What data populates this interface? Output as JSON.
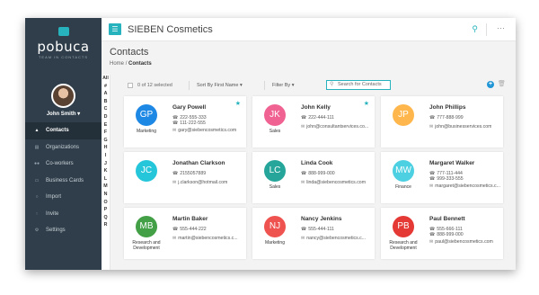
{
  "app": {
    "logo_text": "pobuca",
    "logo_tagline": "TEAM IN CONTACTS",
    "company": "SIEBEN Cosmetics"
  },
  "user": {
    "name": "John Smith ▾"
  },
  "sidebar": {
    "items": [
      {
        "label": "Contacts",
        "icon": "person-icon",
        "active": true
      },
      {
        "label": "Organizations",
        "icon": "building-icon",
        "active": false
      },
      {
        "label": "Co-workers",
        "icon": "people-icon",
        "active": false
      },
      {
        "label": "Business Cards",
        "icon": "card-icon",
        "active": false
      },
      {
        "label": "Import",
        "icon": "import-icon",
        "active": false
      },
      {
        "label": "Invite",
        "icon": "invite-icon",
        "active": false
      },
      {
        "label": "Settings",
        "icon": "gear-icon",
        "active": false
      }
    ]
  },
  "header": {
    "title": "Contacts",
    "breadcrumb_home": "Home",
    "breadcrumb_sep": "/",
    "breadcrumb_current": "Contacts"
  },
  "alphabet": [
    "All",
    "#",
    "A",
    "B",
    "C",
    "D",
    "E",
    "F",
    "G",
    "H",
    "I",
    "J",
    "K",
    "L",
    "M",
    "N",
    "O",
    "P",
    "Q",
    "R"
  ],
  "toolbar": {
    "selected": "0  of  12  selected",
    "sort": "Sort By First Name ▾",
    "filter": "Filter By  ▾",
    "search_placeholder": "Search for Contacts"
  },
  "contacts": [
    {
      "initials": "GP",
      "name": "Gary Powell",
      "phone": "222-555-333",
      "phone2": "111-222-555",
      "email": "gary@siebencosmetics.com",
      "dept": "Marketing",
      "color": "#1e88e5",
      "starred": true
    },
    {
      "initials": "JK",
      "name": "John Kelly",
      "phone": "222-444-111",
      "phone2": "",
      "email": "john@consultantservices.co...",
      "dept": "Sales",
      "color": "#f06292",
      "starred": true
    },
    {
      "initials": "JP",
      "name": "John Phillips",
      "phone": "777-888-999",
      "phone2": "",
      "email": "john@businesservices.com",
      "dept": "",
      "color": "#ffb74d",
      "starred": false
    },
    {
      "initials": "JC",
      "name": "Jonathan Clarkson",
      "phone": "2155057889",
      "phone2": "",
      "email": "j.clarkson@hotmail.com",
      "dept": "",
      "color": "#26c6da",
      "starred": false
    },
    {
      "initials": "LC",
      "name": "Linda Cook",
      "phone": "888-999-000",
      "phone2": "",
      "email": "linda@siebencosmetics.com",
      "dept": "Sales",
      "color": "#26a69a",
      "starred": false
    },
    {
      "initials": "MW",
      "name": "Margaret Walker",
      "phone": "777-111-444",
      "phone2": "999-333-555",
      "email": "margaret@siebencosmetics.c...",
      "dept": "Finance",
      "color": "#4dd0e1",
      "starred": false
    },
    {
      "initials": "MB",
      "name": "Martin Baker",
      "phone": "555-444-222",
      "phone2": "",
      "email": "martin@siebencosmetics.c...",
      "dept": "Research and Development",
      "color": "#43a047",
      "starred": false
    },
    {
      "initials": "NJ",
      "name": "Nancy Jenkins",
      "phone": "555-444-111",
      "phone2": "",
      "email": "nancy@siebencosmetics.c...",
      "dept": "Marketing",
      "color": "#ef5350",
      "starred": false
    },
    {
      "initials": "PB",
      "name": "Paul Bennett",
      "phone": "555-666-111",
      "phone2": "888-999-000",
      "email": "paul@siebencosmetics.com",
      "dept": "Research and Development",
      "color": "#e53935",
      "starred": false
    }
  ]
}
